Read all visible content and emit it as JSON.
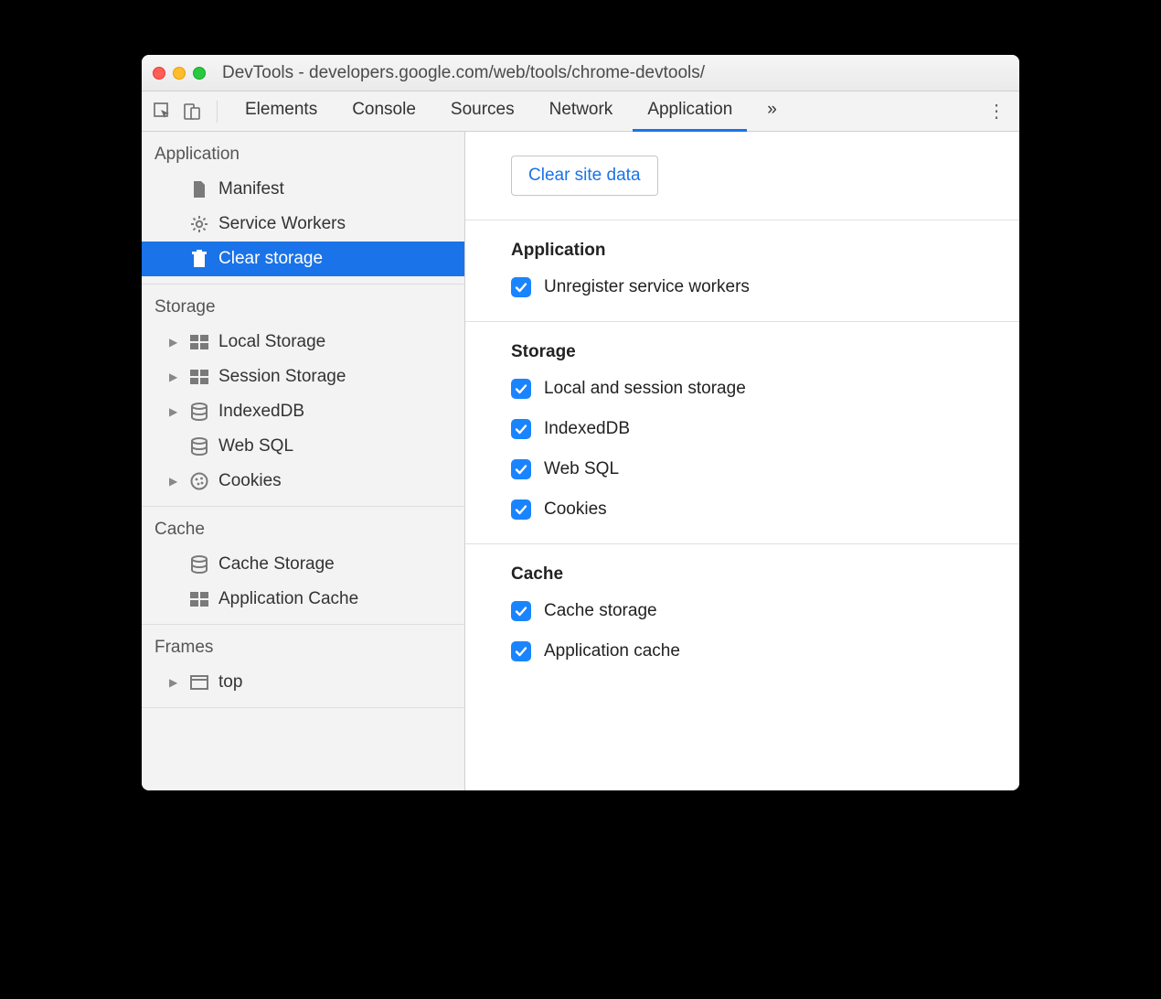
{
  "window": {
    "title": "DevTools - developers.google.com/web/tools/chrome-devtools/"
  },
  "tabs": {
    "items": [
      "Elements",
      "Console",
      "Sources",
      "Network",
      "Application"
    ],
    "active_index": 4,
    "overflow_glyph": "»"
  },
  "sidebar": {
    "groups": [
      {
        "label": "Application",
        "items": [
          {
            "label": "Manifest",
            "icon": "file-icon",
            "arrow": false
          },
          {
            "label": "Service Workers",
            "icon": "gear-icon",
            "arrow": false
          },
          {
            "label": "Clear storage",
            "icon": "trash-icon",
            "arrow": false,
            "selected": true
          }
        ]
      },
      {
        "label": "Storage",
        "items": [
          {
            "label": "Local Storage",
            "icon": "grid-icon",
            "arrow": true
          },
          {
            "label": "Session Storage",
            "icon": "grid-icon",
            "arrow": true
          },
          {
            "label": "IndexedDB",
            "icon": "database-icon",
            "arrow": true
          },
          {
            "label": "Web SQL",
            "icon": "database-icon",
            "arrow": false
          },
          {
            "label": "Cookies",
            "icon": "cookie-icon",
            "arrow": true
          }
        ]
      },
      {
        "label": "Cache",
        "items": [
          {
            "label": "Cache Storage",
            "icon": "database-icon",
            "arrow": false
          },
          {
            "label": "Application Cache",
            "icon": "grid-icon",
            "arrow": false
          }
        ]
      },
      {
        "label": "Frames",
        "items": [
          {
            "label": "top",
            "icon": "frame-icon",
            "arrow": true
          }
        ]
      }
    ]
  },
  "clear_button_label": "Clear site data",
  "sections": [
    {
      "heading": "Application",
      "options": [
        {
          "label": "Unregister service workers",
          "checked": true
        }
      ]
    },
    {
      "heading": "Storage",
      "options": [
        {
          "label": "Local and session storage",
          "checked": true
        },
        {
          "label": "IndexedDB",
          "checked": true
        },
        {
          "label": "Web SQL",
          "checked": true
        },
        {
          "label": "Cookies",
          "checked": true
        }
      ]
    },
    {
      "heading": "Cache",
      "options": [
        {
          "label": "Cache storage",
          "checked": true
        },
        {
          "label": "Application cache",
          "checked": true
        }
      ]
    }
  ]
}
